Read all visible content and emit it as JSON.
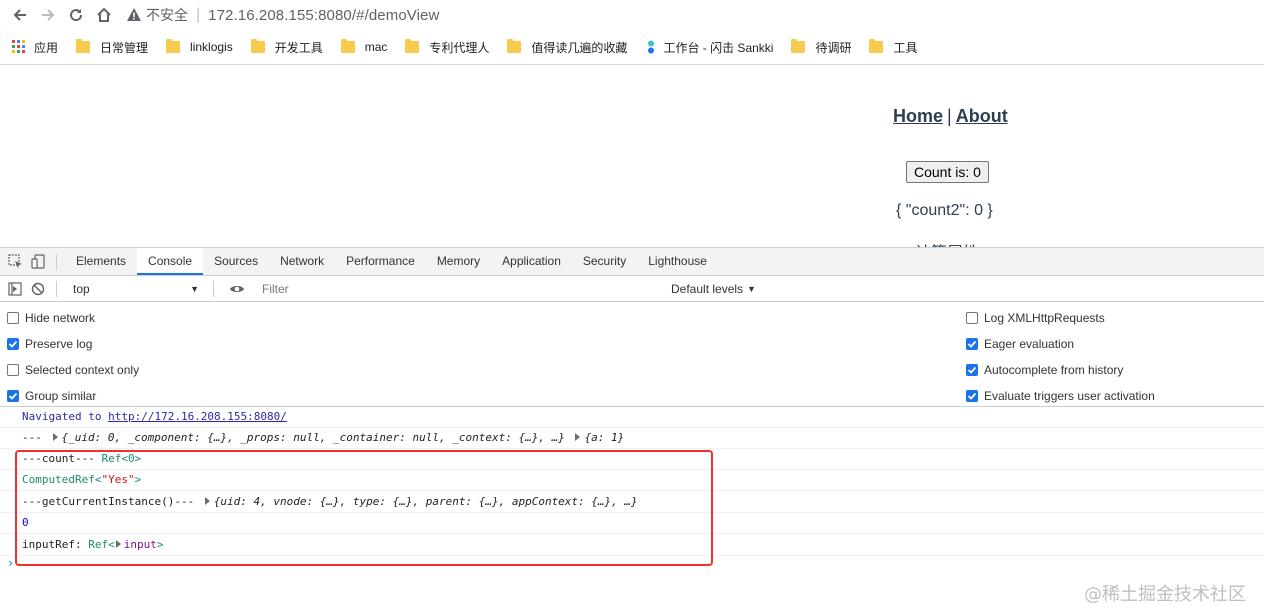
{
  "browser": {
    "insecure_label": "不安全",
    "url": "172.16.208.155:8080/#/demoView",
    "bookmarks": [
      "应用",
      "日常管理",
      "linklogis",
      "开发工具",
      "mac",
      "专利代理人",
      "值得读几遍的收藏",
      "工作台 - 闪击 Sankki",
      "待调研",
      "工具"
    ]
  },
  "page": {
    "nav_home": "Home",
    "nav_sep": "|",
    "nav_about": "About",
    "count_button": "Count is: 0",
    "json_text": "{ \"count2\": 0 }",
    "cut_text": "计算属性"
  },
  "devtools": {
    "tabs": [
      "Elements",
      "Console",
      "Sources",
      "Network",
      "Performance",
      "Memory",
      "Application",
      "Security",
      "Lighthouse"
    ],
    "active_tab": "Console",
    "context": "top",
    "filter_placeholder": "Filter",
    "levels": "Default levels",
    "options_left": [
      {
        "label": "Hide network",
        "checked": false
      },
      {
        "label": "Preserve log",
        "checked": true
      },
      {
        "label": "Selected context only",
        "checked": false
      },
      {
        "label": "Group similar",
        "checked": true
      }
    ],
    "options_right": [
      {
        "label": "Log XMLHttpRequests",
        "checked": false
      },
      {
        "label": "Eager evaluation",
        "checked": true
      },
      {
        "label": "Autocomplete from history",
        "checked": true
      },
      {
        "label": "Evaluate triggers user activation",
        "checked": true
      }
    ]
  },
  "console": {
    "navigated_prefix": "Navigated to ",
    "navigated_url": "http://172.16.208.155:8080/",
    "line1_prefix": "---",
    "line1_obj1": "{_uid: 0, _component: {…}, _props: null, _container: null, _context: {…}, …}",
    "line1_obj2": "{a: 1}",
    "line2_prefix": "---count---",
    "line2_ref": "Ref<0>",
    "line3_ref": "ComputedRef<",
    "line3_str": "\"Yes\"",
    "line3_end": ">",
    "line4_prefix": "---getCurrentInstance()---",
    "line4_obj": "{uid: 4, vnode: {…}, type: {…}, parent: {…}, appContext: {…}, …}",
    "line5_num": "0",
    "line6_prefix": "inputRef:",
    "line6_ref": "Ref<",
    "line6_tag": "input",
    "line6_end": ">"
  },
  "watermark": "@稀土掘金技术社区",
  "colors": {
    "highlight": "#f0302a",
    "active_tab": "#1a73e8",
    "checkbox": "#1a73e8"
  }
}
